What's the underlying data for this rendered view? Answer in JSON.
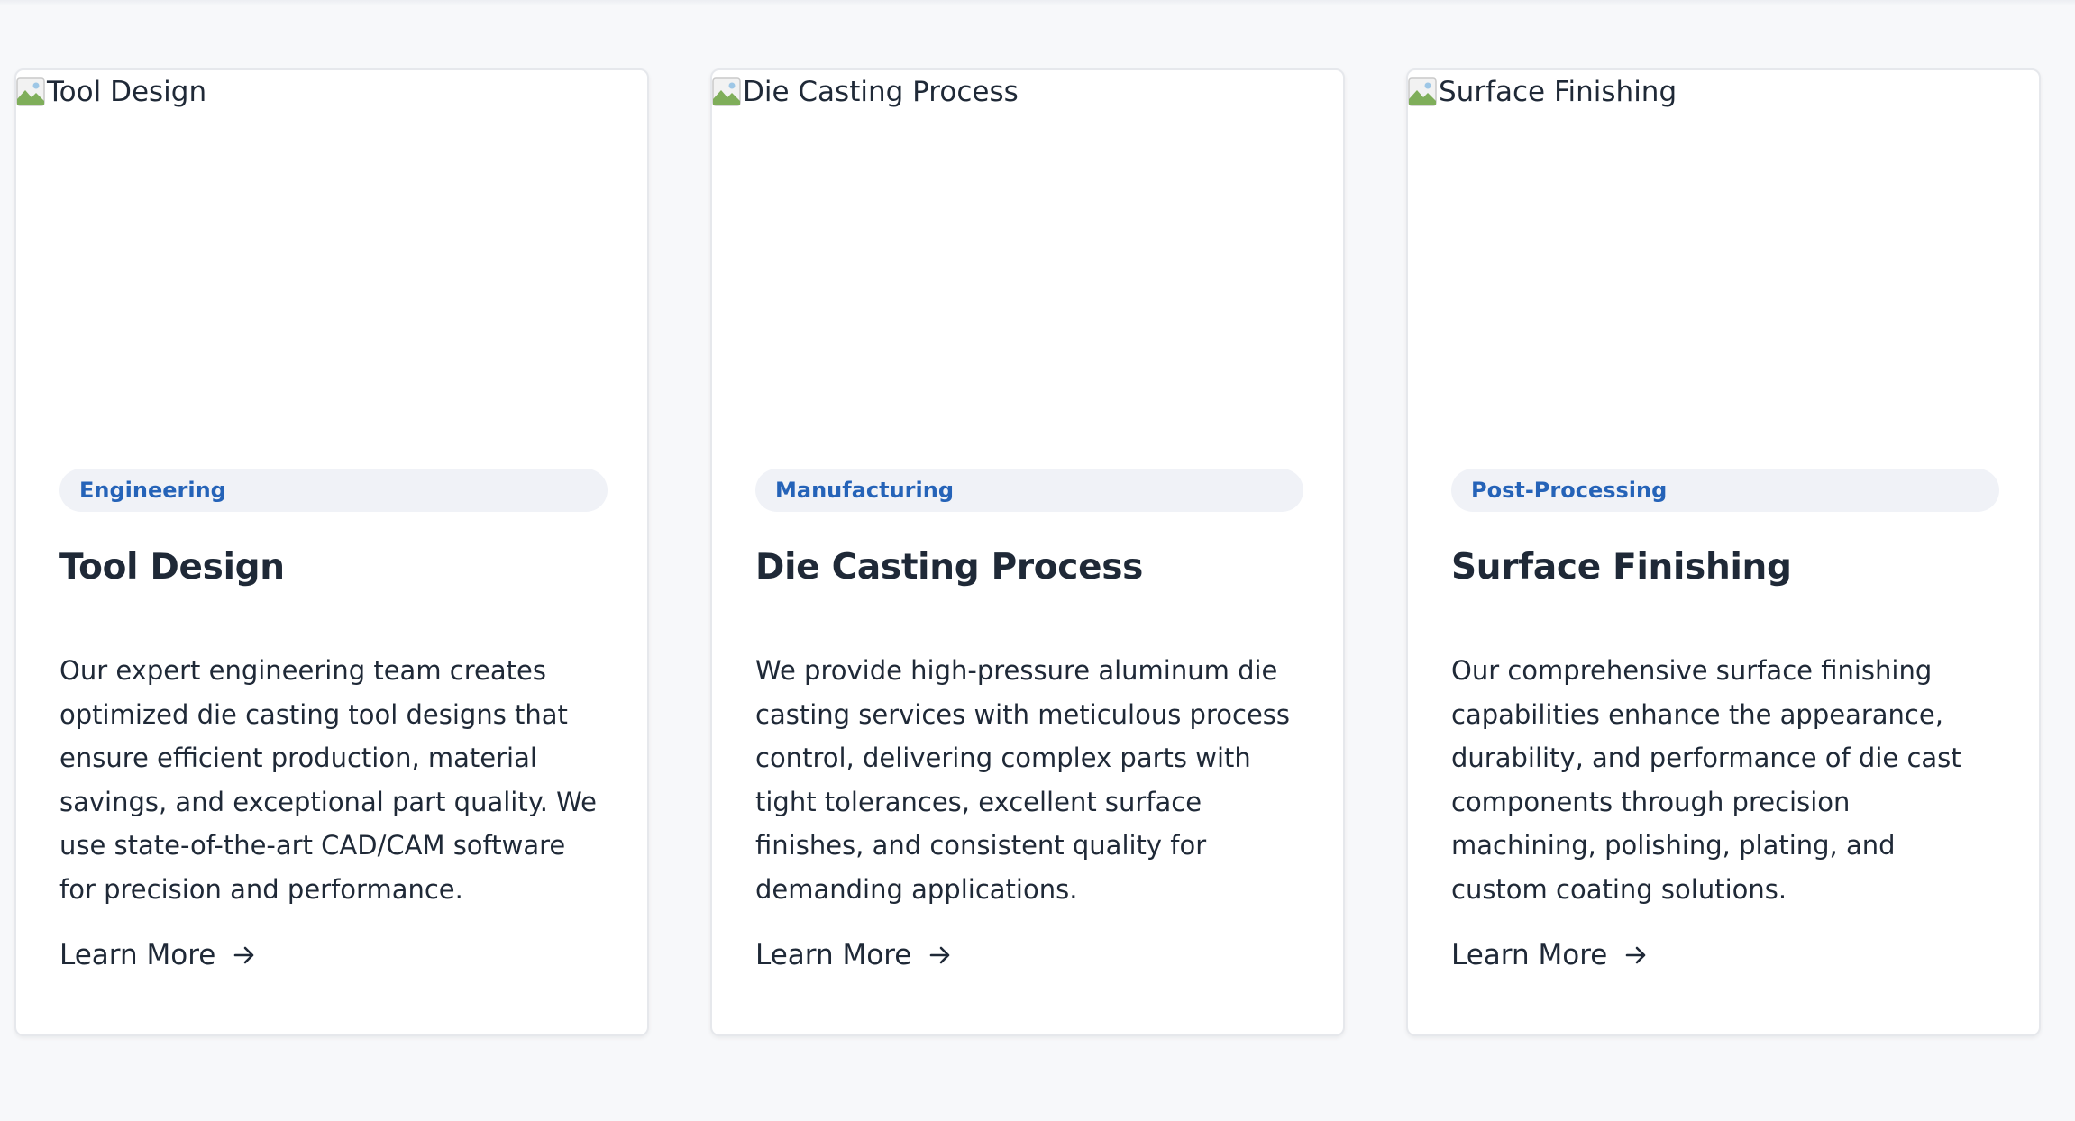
{
  "cards": [
    {
      "image_alt": "Tool Design",
      "category": "Engineering",
      "title": "Tool Design",
      "description": "Our expert engineering team creates optimized die casting tool designs that ensure efficient production, material savings, and exceptional part quality. We use state-of-the-art CAD/CAM software for precision and performance.",
      "link_label": "Learn More",
      "link_icon": "arrow-right-icon"
    },
    {
      "image_alt": "Die Casting Process",
      "category": "Manufacturing",
      "title": "Die Casting Process",
      "description": "We provide high-pressure aluminum die casting services with meticulous process control, delivering complex parts with tight tolerances, excellent surface finishes, and consistent quality for demanding applications.",
      "link_label": "Learn More",
      "link_icon": "arrow-right-icon"
    },
    {
      "image_alt": "Surface Finishing",
      "category": "Post-Processing",
      "title": "Surface Finishing",
      "description": "Our comprehensive surface finishing capabilities enhance the appearance, durability, and performance of die cast components through precision machining, polishing, plating, and custom coating solutions.",
      "link_label": "Learn More",
      "link_icon": "arrow-right-icon"
    }
  ],
  "colors": {
    "page_background": "#f7f8fa",
    "card_background": "#ffffff",
    "badge_background": "#f0f2f7",
    "badge_text": "#2563b8",
    "text": "#1f2937"
  }
}
